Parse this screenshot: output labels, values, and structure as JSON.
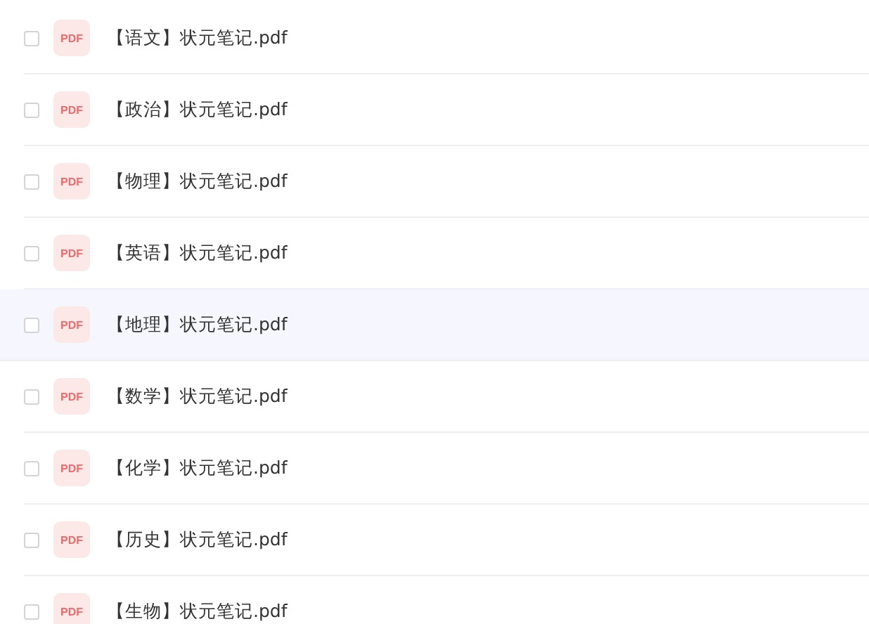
{
  "files": [
    {
      "name": "【语文】状元笔记.pdf",
      "badge": "PDF",
      "checked": false,
      "highlighted": false
    },
    {
      "name": "【政治】状元笔记.pdf",
      "badge": "PDF",
      "checked": false,
      "highlighted": false
    },
    {
      "name": "【物理】状元笔记.pdf",
      "badge": "PDF",
      "checked": false,
      "highlighted": false
    },
    {
      "name": "【英语】状元笔记.pdf",
      "badge": "PDF",
      "checked": false,
      "highlighted": false
    },
    {
      "name": "【地理】状元笔记.pdf",
      "badge": "PDF",
      "checked": false,
      "highlighted": true
    },
    {
      "name": "【数学】状元笔记.pdf",
      "badge": "PDF",
      "checked": false,
      "highlighted": false
    },
    {
      "name": "【化学】状元笔记.pdf",
      "badge": "PDF",
      "checked": false,
      "highlighted": false
    },
    {
      "name": "【历史】状元笔记.pdf",
      "badge": "PDF",
      "checked": false,
      "highlighted": false
    },
    {
      "name": "【生物】状元笔记.pdf",
      "badge": "PDF",
      "checked": false,
      "highlighted": false
    }
  ]
}
